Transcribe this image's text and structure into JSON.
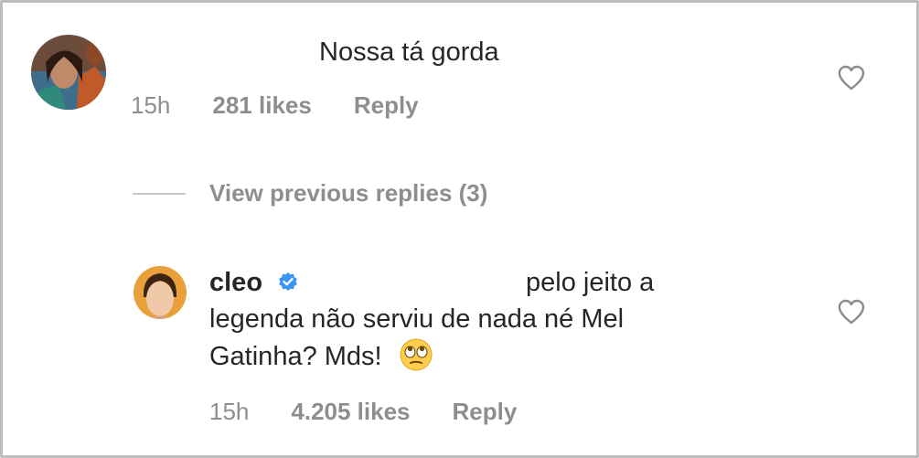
{
  "comment1": {
    "text": "Nossa tá gorda",
    "time": "15h",
    "likes": "281 likes",
    "reply": "Reply",
    "like_icon": "heart-outline-icon"
  },
  "view_replies": {
    "label": "View previous replies (3)"
  },
  "comment2": {
    "username": "cleo",
    "verified_icon": "verified-badge-icon",
    "text_line1": "pelo jeito a",
    "text_line2": "legenda não serviu de nada né Mel",
    "text_line3": "Gatinha? Mds!",
    "emoji": "face-with-rolling-eyes",
    "time": "15h",
    "likes": "4.205 likes",
    "reply": "Reply",
    "like_icon": "heart-outline-icon"
  },
  "colors": {
    "text": "#262626",
    "secondary": "#8e8e8e",
    "verified": "#3897f0",
    "border": "#bdbdbd"
  }
}
